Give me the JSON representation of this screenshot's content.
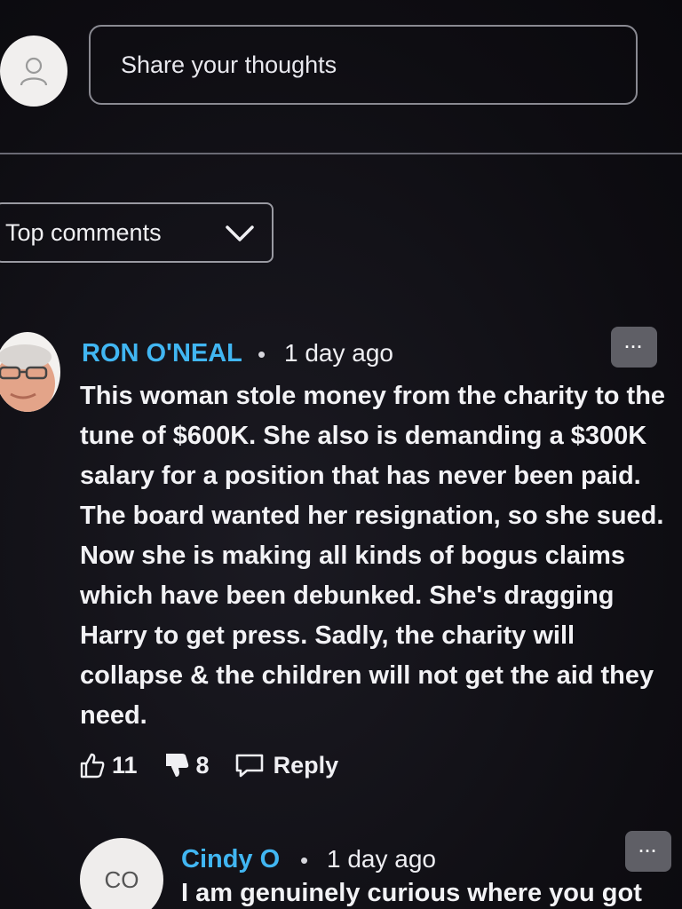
{
  "composer": {
    "placeholder": "Share your thoughts",
    "avatar_icon": "user-silhouette-icon"
  },
  "sort": {
    "selected": "Top comments",
    "icon": "chevron-down-icon"
  },
  "comments": [
    {
      "author": "RON O'NEAL",
      "separator": "•",
      "time": "1 day ago",
      "body": "This woman stole money from the charity to the tune of $600K. She also is demanding a $300K salary for a position that has never been paid. The board wanted her resignation, so she sued. Now she is making all kinds of bogus claims which have been debunked. She's dragging Harry to get press. Sadly, the charity will collapse & the children will not get the aid they need.",
      "likes": "11",
      "dislikes": "8",
      "reply_label": "Reply",
      "more_label": "···"
    },
    {
      "author": "Cindy O",
      "initials": "CO",
      "separator": "•",
      "time": "1 day ago",
      "body": "I am genuinely curious where you got",
      "more_label": "···"
    }
  ],
  "colors": {
    "author": "#41b6f2",
    "background": "#111015",
    "text": "#f2f2f5"
  }
}
